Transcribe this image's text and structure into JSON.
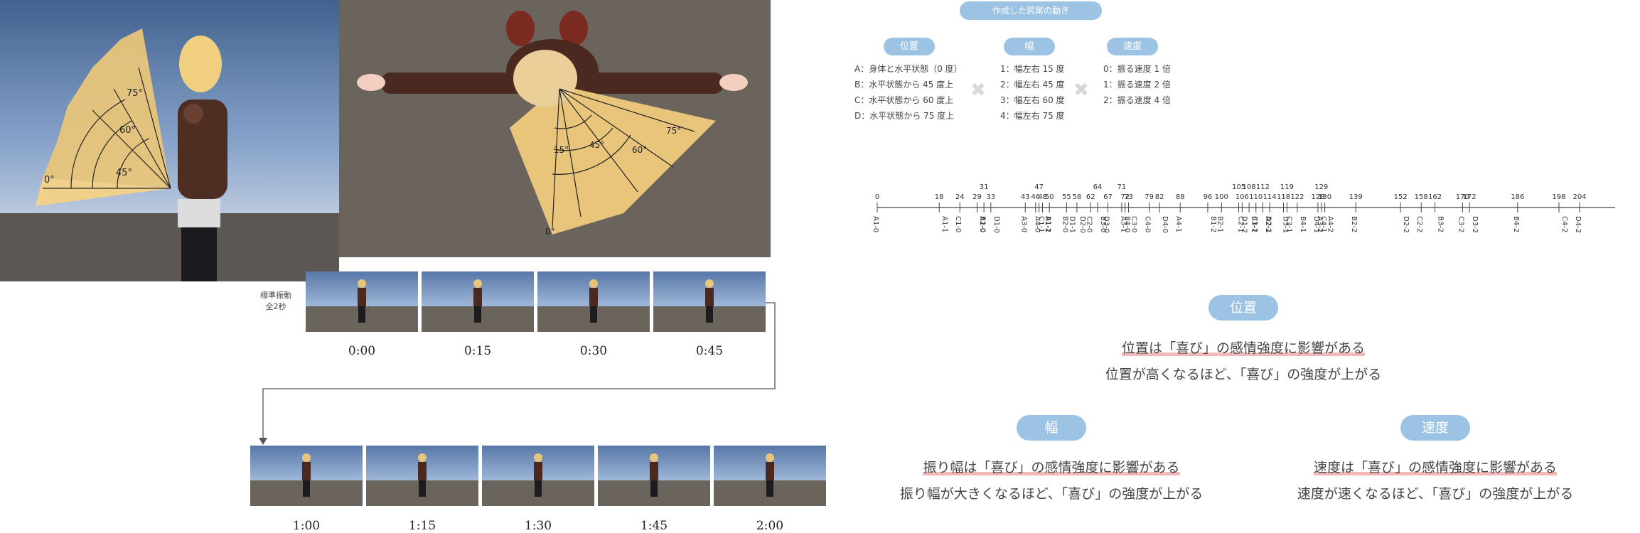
{
  "top_left_angles": [
    "75°",
    "60°",
    "45°",
    "0°"
  ],
  "top_mid_angles": [
    "15°",
    "45°",
    "60°",
    "75°",
    "0°"
  ],
  "tl_header": "作成した尻尾の動き",
  "legend": {
    "position": {
      "title": "位置",
      "items": [
        "A：身体と水平状態（0 度）",
        "B：水平状態から 45 度上",
        "C：水平状態から 60 度上",
        "D：水平状態から 75 度上"
      ]
    },
    "width": {
      "title": "幅",
      "items": [
        "1：幅左右 15 度",
        "2：幅左右 45 度",
        "3：幅左右 60 度",
        "4：幅左右 75 度"
      ]
    },
    "speed": {
      "title": "速度",
      "items": [
        "0：振る速度 1 倍",
        "1：振る速度 2 倍",
        "2：振る速度 4 倍"
      ]
    }
  },
  "standard_label": "標準振動\n全2秒",
  "timeline_top": [
    "0:00",
    "0:15",
    "0:30",
    "0:45"
  ],
  "timeline_bottom": [
    "1:00",
    "1:15",
    "1:30",
    "1:45",
    "2:00"
  ],
  "axis": {
    "values": [
      "0",
      "18",
      "24",
      "29",
      "31",
      "33",
      "43",
      "46",
      "47",
      "48",
      "50",
      "55",
      "58",
      "62",
      "64",
      "67",
      "71",
      "72",
      "73",
      "79",
      "82",
      "88",
      "96",
      "100",
      "105",
      "106",
      "108",
      "110",
      "112",
      "114",
      "118",
      "119",
      "122",
      "128",
      "129",
      "130",
      "139",
      "152",
      "158",
      "162",
      "170",
      "172",
      "186",
      "198",
      "204"
    ],
    "highlight": "100",
    "highlight_color": "#e07070",
    "codes": [
      "A1-0",
      "A1-1",
      "C1-0",
      "B1-0",
      "A2-0",
      "D1-0",
      "A3-0",
      "C1-1",
      "A4-0",
      "A1-2",
      "B1-1",
      "D1-1",
      "B2-0",
      "D2-0",
      "C2-0",
      "B3-0",
      "D3-0",
      "B4-0",
      "A3-1",
      "C3-0",
      "C4-0",
      "D4-0",
      "A4-1",
      "B1-2",
      "B2-1",
      "D1-2",
      "C2-1",
      "C1-2",
      "B3-1",
      "D2-1",
      "A2-2",
      "C3-1",
      "D3-1",
      "B4-1",
      "D4-1",
      "C4-1",
      "A3-2",
      "A4-2",
      "B2-2",
      "D2-2",
      "C2-2",
      "B3-2",
      "C3-2",
      "D3-2",
      "B4-2",
      "C4-2",
      "D4-2"
    ]
  },
  "findings": {
    "position": {
      "title": "位置",
      "line1": "位置は「喜び」の感情強度に影響がある",
      "line2": "位置が高くなるほど、「喜び」の強度が上がる"
    },
    "width": {
      "title": "幅",
      "line1": "振り幅は「喜び」の感情強度に影響がある",
      "line2": "振り幅が大きくなるほど、「喜び」の強度が上がる"
    },
    "speed": {
      "title": "速度",
      "line1": "速度は「喜び」の感情強度に影響がある",
      "line2": "速度が速くなるほど、「喜び」の強度が上がる"
    }
  },
  "colors": {
    "pill": "#9cc3e3",
    "underline": "#f2b8b8",
    "highlight": "#e07070"
  }
}
